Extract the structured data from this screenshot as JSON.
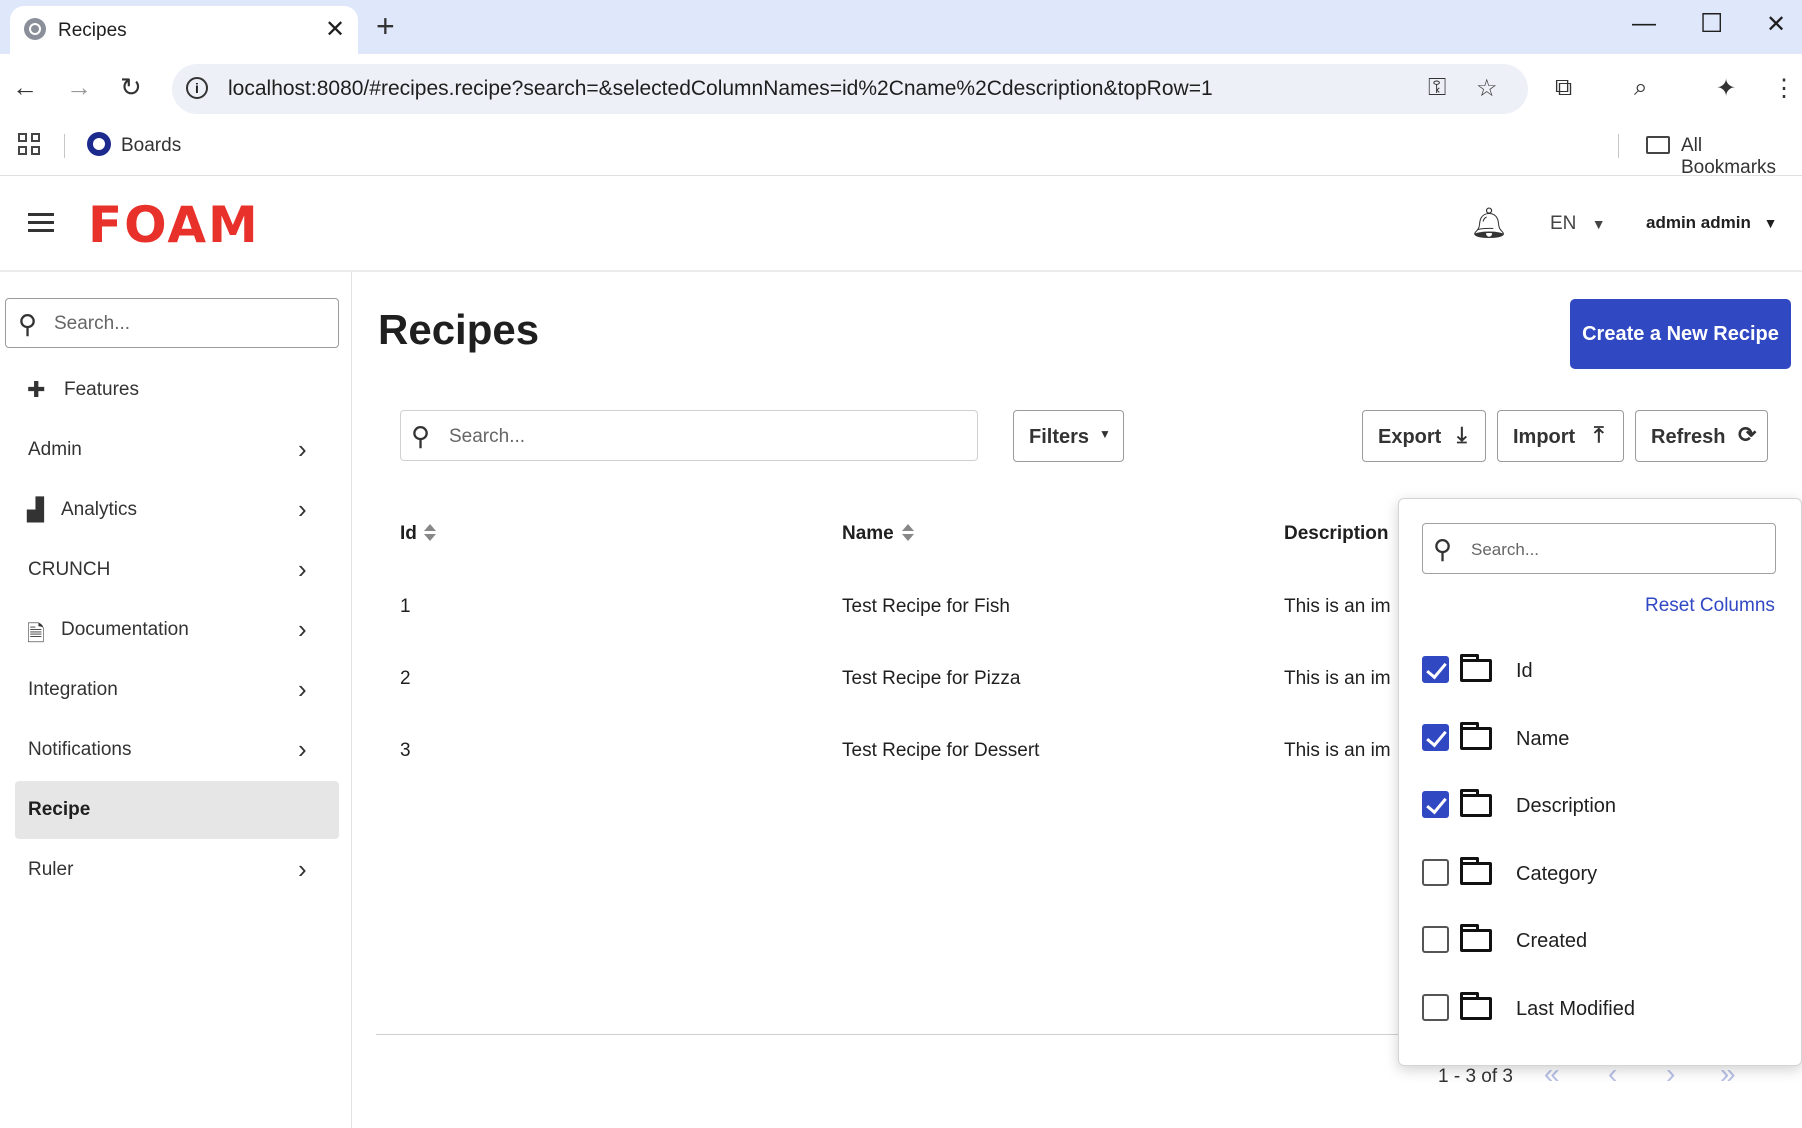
{
  "browser": {
    "tab_title": "Recipes",
    "url": "localhost:8080/#recipes.recipe?search=&selectedColumnNames=id%2Cname%2Cdescription&topRow=1",
    "bookmarks": [
      "Boards"
    ],
    "all_bookmarks_label": "All Bookmarks"
  },
  "header": {
    "logo": "FOAM",
    "language": "EN",
    "user": "admin admin"
  },
  "sidebar": {
    "search_placeholder": "Search...",
    "items": [
      {
        "label": "Features",
        "icon": "puzzle-icon",
        "chevron": false
      },
      {
        "label": "Admin",
        "icon": "",
        "chevron": true
      },
      {
        "label": "Analytics",
        "icon": "chart-icon",
        "chevron": true
      },
      {
        "label": "CRUNCH",
        "icon": "",
        "chevron": true
      },
      {
        "label": "Documentation",
        "icon": "document-icon",
        "chevron": true
      },
      {
        "label": "Integration",
        "icon": "",
        "chevron": true
      },
      {
        "label": "Notifications",
        "icon": "",
        "chevron": true
      },
      {
        "label": "Recipe",
        "icon": "",
        "chevron": false,
        "active": true
      },
      {
        "label": "Ruler",
        "icon": "",
        "chevron": true
      }
    ]
  },
  "main": {
    "title": "Recipes",
    "create_button": "Create a New Recipe",
    "search_placeholder": "Search...",
    "filters_label": "Filters",
    "export_label": "Export",
    "import_label": "Import",
    "refresh_label": "Refresh",
    "columns": [
      "Id",
      "Name",
      "Description"
    ],
    "rows": [
      {
        "id": "1",
        "name": "Test Recipe for Fish",
        "description": "This is an im"
      },
      {
        "id": "2",
        "name": "Test Recipe for Pizza",
        "description": "This is an im"
      },
      {
        "id": "3",
        "name": "Test Recipe for Dessert",
        "description": "This is an im"
      }
    ],
    "pagination": "1 - 3 of 3"
  },
  "column_popup": {
    "search_placeholder": "Search...",
    "reset_label": "Reset Columns",
    "options": [
      {
        "label": "Id",
        "checked": true
      },
      {
        "label": "Name",
        "checked": true
      },
      {
        "label": "Description",
        "checked": true
      },
      {
        "label": "Category",
        "checked": false
      },
      {
        "label": "Created",
        "checked": false
      },
      {
        "label": "Last Modified",
        "checked": false
      }
    ]
  },
  "colors": {
    "brand_red": "#e8312a",
    "primary_blue": "#3148c3",
    "active_bg": "#e6e6e6"
  }
}
